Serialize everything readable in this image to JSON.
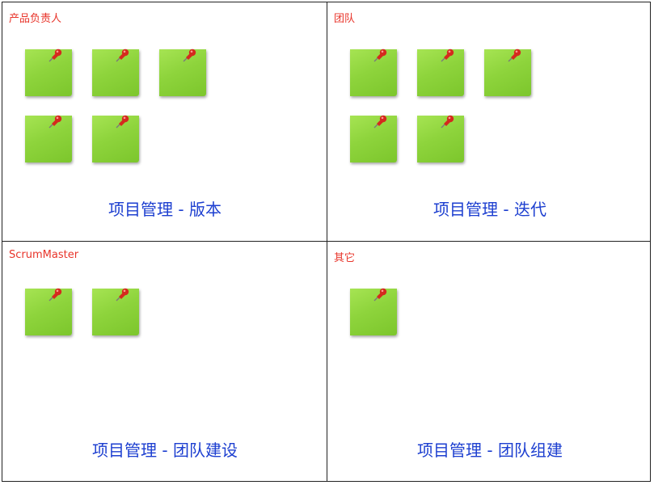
{
  "quadrants": [
    {
      "label": "产品负责人",
      "caption": "项目管理 - 版本",
      "note_count": 5
    },
    {
      "label": "团队",
      "caption": "项目管理 - 迭代",
      "note_count": 5
    },
    {
      "label": "ScrumMaster",
      "caption": "项目管理 - 团队建设",
      "note_count": 2
    },
    {
      "label": "其它",
      "caption": "项目管理 - 团队组建",
      "note_count": 1
    }
  ],
  "colors": {
    "label": "#e8342a",
    "caption": "#1d3fd0",
    "note": "#8ed43c",
    "pin": "#d42a1e"
  },
  "icons": {
    "note": "sticky-note-icon",
    "pin": "push-pin-icon"
  }
}
